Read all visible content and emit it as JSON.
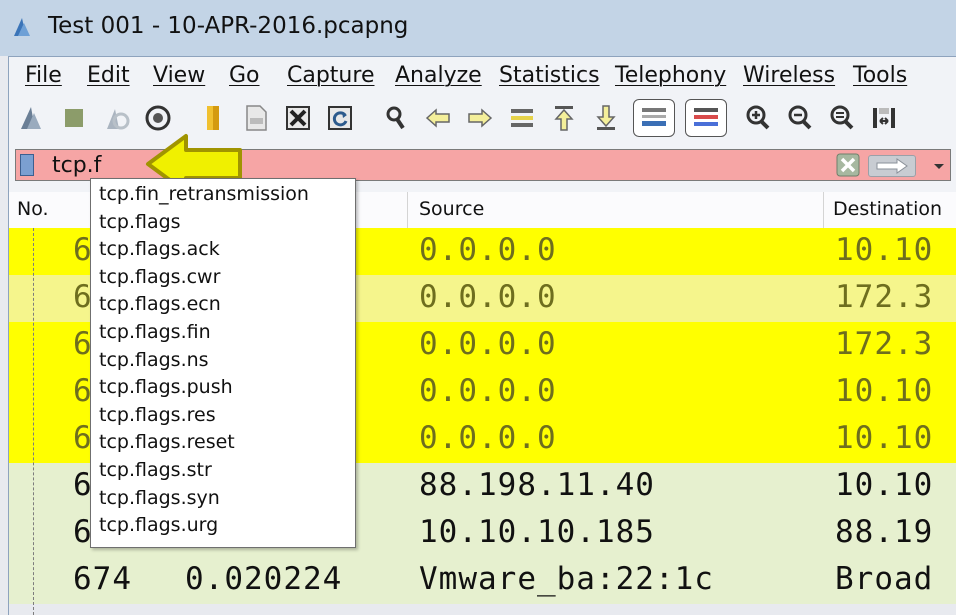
{
  "window": {
    "title": "Test 001 - 10-APR-2016.pcapng",
    "app_icon": "wireshark-fin-icon"
  },
  "menu": [
    "File",
    "Edit",
    "View",
    "Go",
    "Capture",
    "Analyze",
    "Statistics",
    "Telephony",
    "Wireless",
    "Tools"
  ],
  "toolbar": {
    "icons": [
      "start-capture-icon",
      "stop-capture-icon",
      "restart-capture-icon",
      "capture-options-icon",
      "open-file-icon",
      "save-file-icon",
      "close-file-icon",
      "reload-file-icon",
      "find-packet-icon",
      "go-back-icon",
      "go-forward-icon",
      "go-to-packet-icon",
      "first-packet-icon",
      "last-packet-icon",
      "auto-scroll-icon",
      "colorize-icon",
      "zoom-in-icon",
      "zoom-out-icon",
      "normal-size-icon",
      "resize-columns-icon"
    ]
  },
  "filter": {
    "value": "tcp.f",
    "state_color": "#f6a5a5"
  },
  "columns": {
    "no": "No.",
    "source": "Source",
    "destination": "Destination"
  },
  "colors": {
    "highlight_yellow": "#ffff00",
    "light_yellow": "#f5f58c",
    "row_green": "#e6f0cf",
    "cell_text_yellow_rows": "#6e6e1e",
    "cell_text_green_rows": "#111111",
    "arrow_fill": "#f0f000",
    "arrow_stroke": "#a09400"
  },
  "packets": [
    {
      "no": "6",
      "time": "",
      "source": "0.0.0.0",
      "destination": "10.10",
      "bg": "#ffff00"
    },
    {
      "no": "6",
      "time": "",
      "source": "0.0.0.0",
      "destination": "172.3",
      "bg": "#f5f58c"
    },
    {
      "no": "6",
      "time": "",
      "source": "0.0.0.0",
      "destination": "172.3",
      "bg": "#ffff00"
    },
    {
      "no": "6",
      "time": "",
      "source": "0.0.0.0",
      "destination": "10.10",
      "bg": "#ffff00"
    },
    {
      "no": "6",
      "time": "",
      "source": "0.0.0.0",
      "destination": "10.10",
      "bg": "#ffff00"
    },
    {
      "no": "6",
      "time": "",
      "source": "88.198.11.40",
      "destination": "10.10",
      "bg": "#e6f0cf"
    },
    {
      "no": "6",
      "time": "",
      "source": "10.10.10.185",
      "destination": "88.19",
      "bg": "#e6f0cf"
    },
    {
      "no": "674",
      "time": "0.020224",
      "source": "Vmware_ba:22:1c",
      "destination": "Broad",
      "bg": "#e6f0cf"
    }
  ],
  "autocomplete": [
    "tcp.fin_retransmission",
    "tcp.flags",
    "tcp.flags.ack",
    "tcp.flags.cwr",
    "tcp.flags.ecn",
    "tcp.flags.fin",
    "tcp.flags.ns",
    "tcp.flags.push",
    "tcp.flags.res",
    "tcp.flags.reset",
    "tcp.flags.str",
    "tcp.flags.syn",
    "tcp.flags.urg"
  ]
}
